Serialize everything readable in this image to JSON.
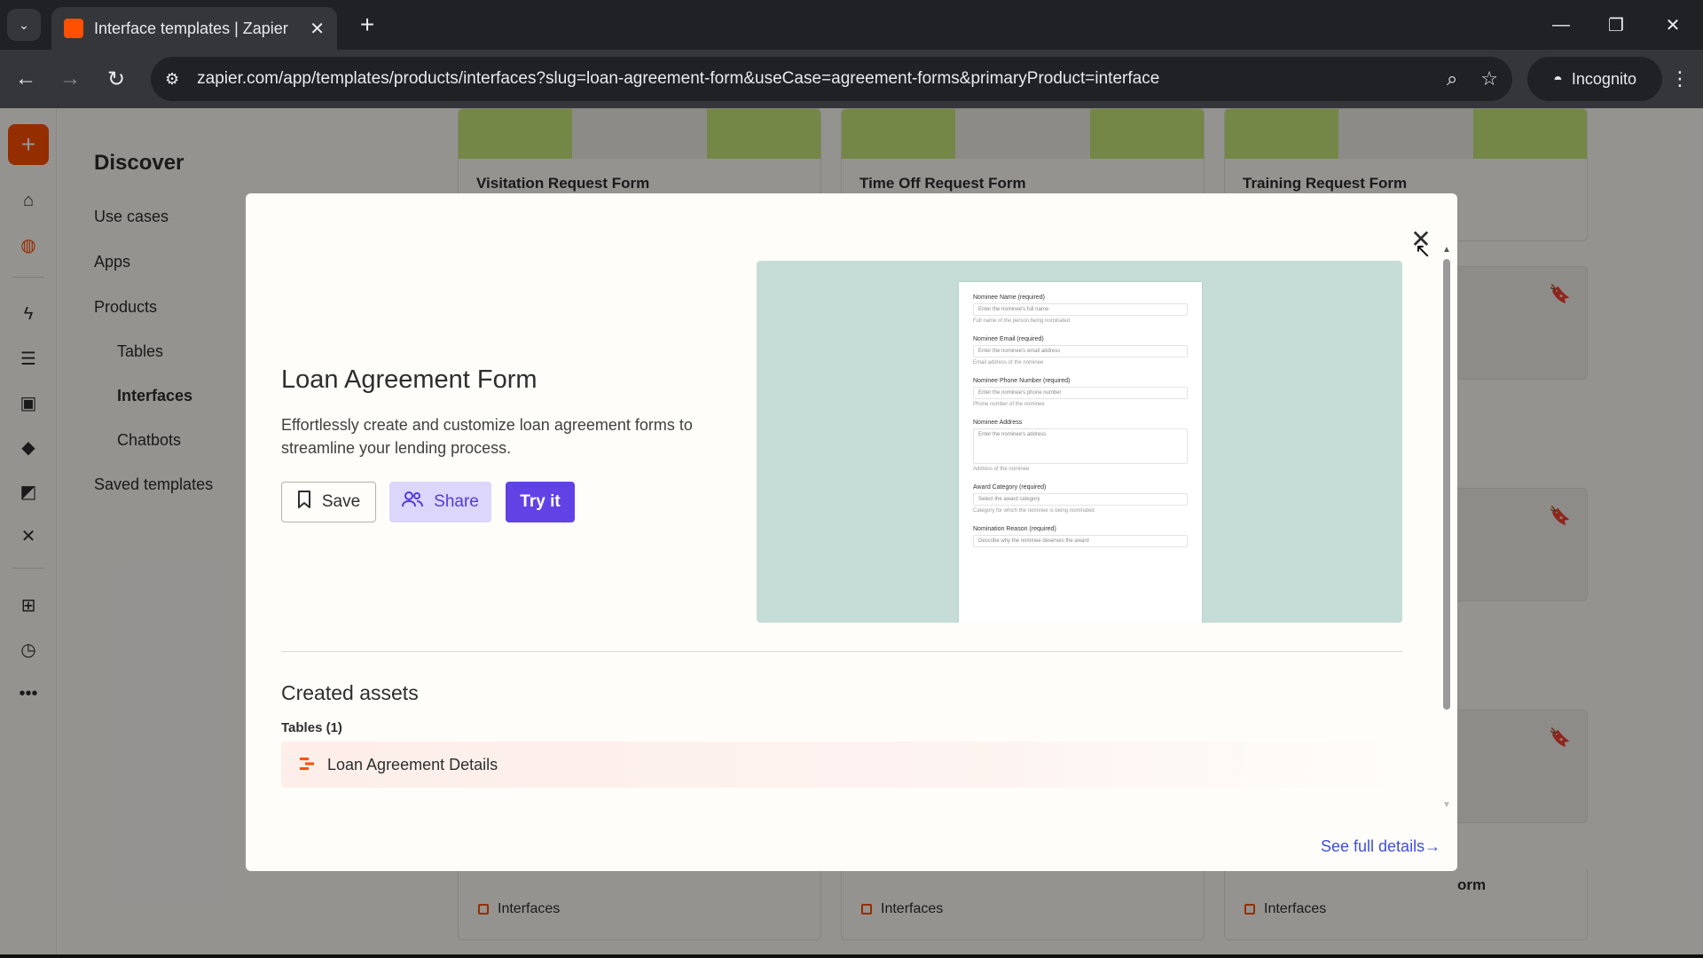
{
  "browser": {
    "tab_title": "Interface templates | Zapier",
    "url": "zapier.com/app/templates/products/interfaces?slug=loan-agreement-form&useCase=agreement-forms&primaryProduct=interface",
    "incognito_label": "Incognito"
  },
  "sidebar": {
    "title": "Discover",
    "items": [
      {
        "label": "Use cases"
      },
      {
        "label": "Apps"
      },
      {
        "label": "Products"
      },
      {
        "label": "Tables"
      },
      {
        "label": "Interfaces"
      },
      {
        "label": "Chatbots"
      },
      {
        "label": "Saved templates"
      }
    ]
  },
  "rail_icons": [
    "home-icon",
    "globe-icon",
    "zap-icon",
    "tables-icon",
    "interfaces-icon",
    "chatbots-icon",
    "canvas-icon",
    "transfer-icon",
    "apps-icon",
    "history-icon",
    "more-icon"
  ],
  "cards": [
    {
      "title": "Visitation Request Form",
      "footer": "Interfaces"
    },
    {
      "title": "Time Off Request Form",
      "footer": "Interfaces"
    },
    {
      "title": "Training Request Form",
      "footer": "Interfaces"
    },
    {
      "partial_title": "orm"
    }
  ],
  "modal": {
    "title": "Loan Agreement Form",
    "description": "Effortlessly create and customize loan agreement forms to streamline your lending process.",
    "buttons": {
      "save": "Save",
      "share": "Share",
      "try": "Try it"
    },
    "preview_form": [
      {
        "label": "Nominee Name (required)",
        "placeholder": "Enter the nominee's full name",
        "hint": "Full name of the person being nominated"
      },
      {
        "label": "Nominee Email (required)",
        "placeholder": "Enter the nominee's email address",
        "hint": "Email address of the nominee"
      },
      {
        "label": "Nominee Phone Number (required)",
        "placeholder": "Enter the nominee's phone number",
        "hint": "Phone number of the nominee"
      },
      {
        "label": "Nominee Address",
        "placeholder": "Enter the nominee's address",
        "hint": "Address of the nominee"
      },
      {
        "label": "Award Category (required)",
        "placeholder": "Select the award category",
        "hint": "Category for which the nominee is being nominated"
      },
      {
        "label": "Nomination Reason (required)",
        "placeholder": "Describe why the nominee deserves the award",
        "hint": ""
      }
    ],
    "created_assets_title": "Created assets",
    "tables_label": "Tables (1)",
    "asset_name": "Loan Agreement Details",
    "see_full_details": "See full details→"
  },
  "colors": {
    "zapier_orange": "#ff4f00",
    "primary_purple": "#6142e4",
    "share_bg": "#dcd6fb",
    "link_blue": "#3d4fd8"
  }
}
